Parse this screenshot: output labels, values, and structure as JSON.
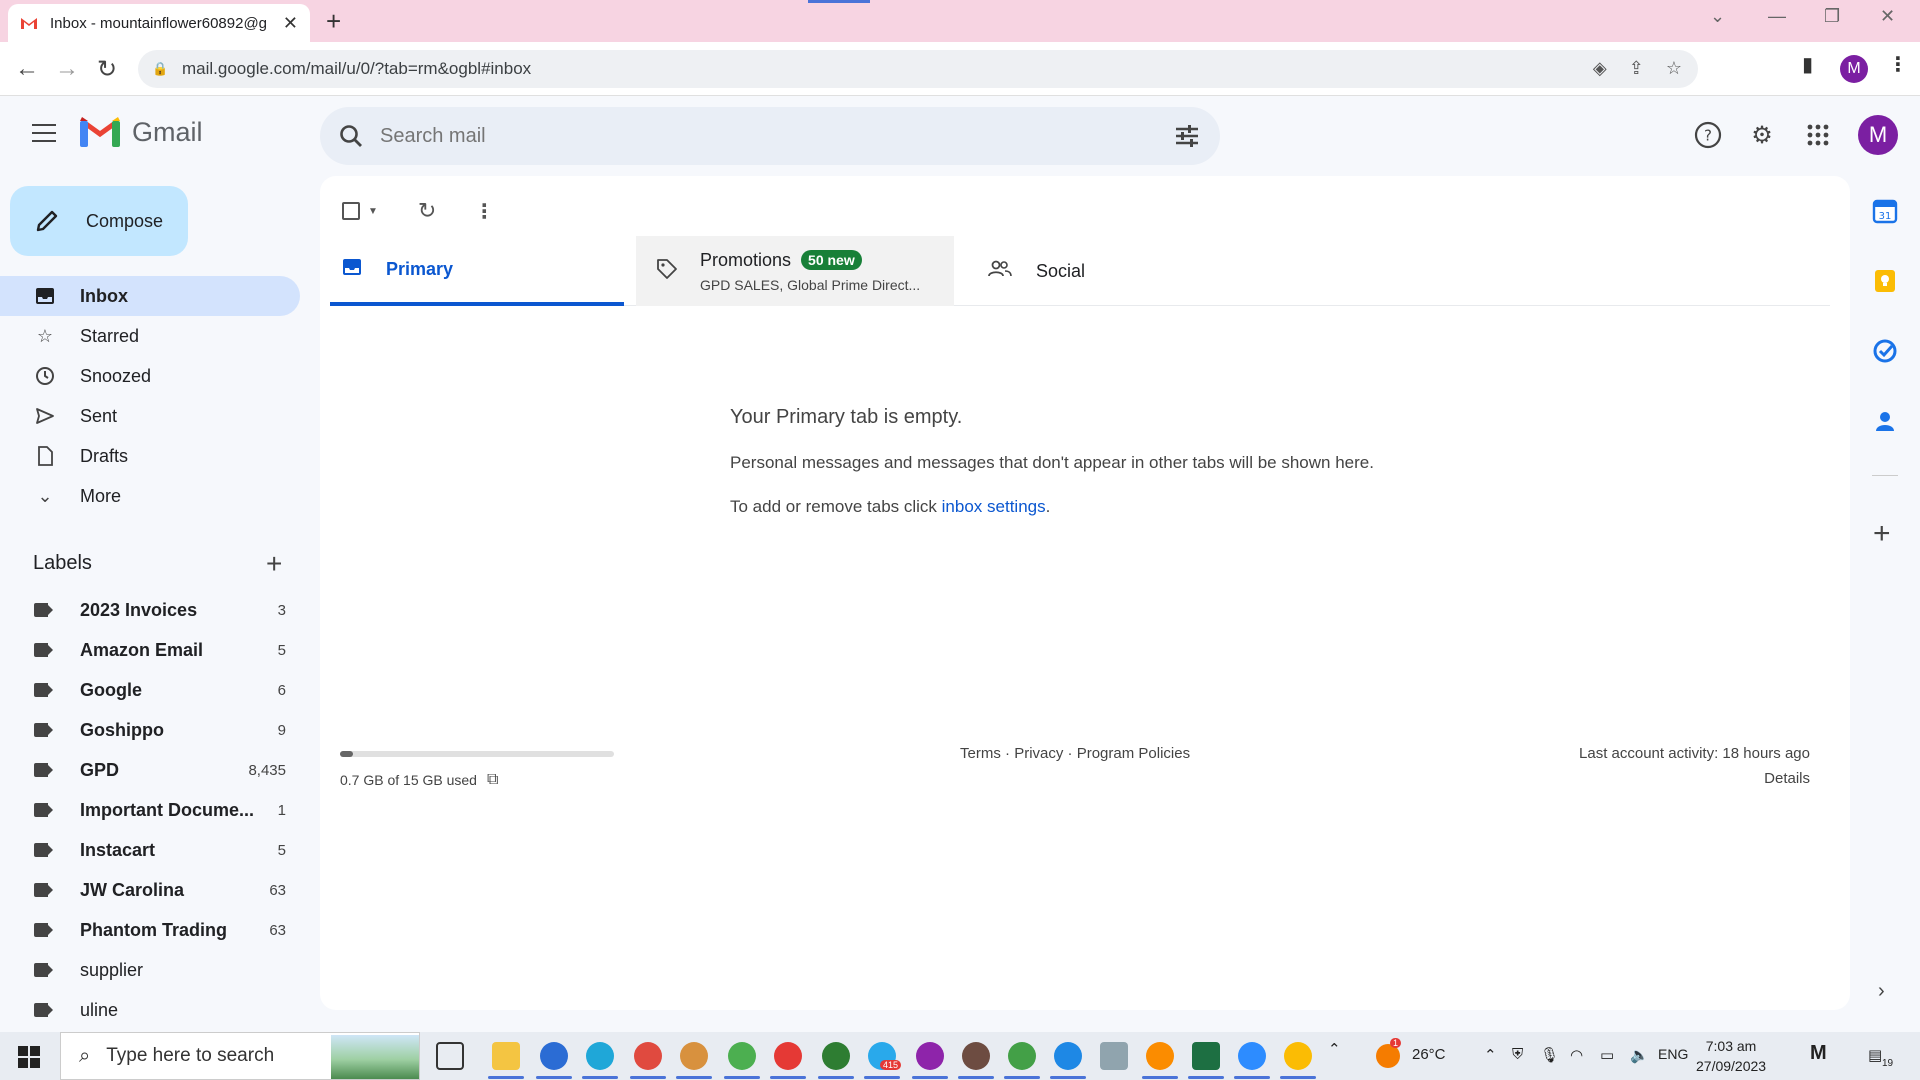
{
  "browser": {
    "tab_title": "Inbox - mountainflower60892@g",
    "url": "mail.google.com/mail/u/0/?tab=rm&ogbl#inbox",
    "profile_initial": "M"
  },
  "gmail": {
    "brand": "Gmail",
    "search_placeholder": "Search mail",
    "avatar_initial": "M"
  },
  "compose_label": "Compose",
  "nav": [
    {
      "label": "Inbox"
    },
    {
      "label": "Starred"
    },
    {
      "label": "Snoozed"
    },
    {
      "label": "Sent"
    },
    {
      "label": "Drafts"
    },
    {
      "label": "More"
    }
  ],
  "labels_heading": "Labels",
  "labels": [
    {
      "name": "2023 Invoices",
      "count": "3"
    },
    {
      "name": "Amazon Email",
      "count": "5"
    },
    {
      "name": "Google",
      "count": "6"
    },
    {
      "name": "Goshippo",
      "count": "9"
    },
    {
      "name": "GPD",
      "count": "8,435"
    },
    {
      "name": "Important Docume...",
      "count": "1"
    },
    {
      "name": "Instacart",
      "count": "5"
    },
    {
      "name": "JW Carolina",
      "count": "63"
    },
    {
      "name": "Phantom Trading",
      "count": "63"
    },
    {
      "name": "supplier",
      "count": ""
    },
    {
      "name": "uline",
      "count": ""
    }
  ],
  "tabs": {
    "primary": "Primary",
    "promotions": "Promotions",
    "promotions_badge": "50 new",
    "promotions_senders": "GPD SALES, Global Prime Direct...",
    "social": "Social"
  },
  "empty": {
    "title": "Your Primary tab is empty.",
    "message": "Personal messages and messages that don't appear in other tabs will be shown here.",
    "tabs_prefix": "To add or remove tabs click ",
    "tabs_link": "inbox settings",
    "tabs_suffix": "."
  },
  "footer": {
    "storage_used": "0.7 GB of 15 GB used",
    "storage_fraction": 0.047,
    "terms": "Terms",
    "privacy": "Privacy",
    "policies": "Program Policies",
    "sep": " · ",
    "last_activity": "Last account activity: 18 hours ago",
    "details": "Details"
  },
  "taskbar": {
    "search_placeholder": "Type here to search",
    "temperature": "26°C",
    "language": "ENG",
    "time": "7:03 am",
    "date": "27/09/2023",
    "notification_count": "19",
    "telegram_badge": "415",
    "weather_badge": "1"
  },
  "colors": {
    "accent": "#0b57d0",
    "compose_bg": "#c2e7ff",
    "inbox_active_bg": "#d3e3fd",
    "promo_badge": "#188038",
    "avatar": "#7b1fa2"
  }
}
